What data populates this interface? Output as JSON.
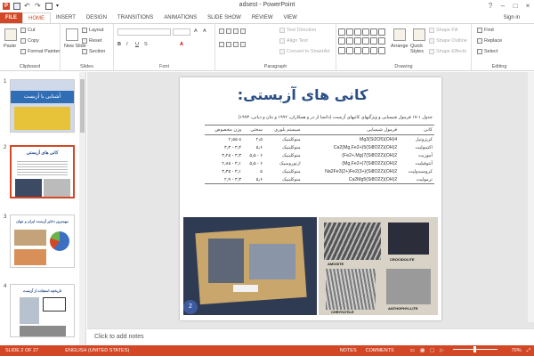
{
  "window": {
    "title": "adsest - PowerPoint",
    "controls": [
      "?",
      "–",
      "□",
      "×"
    ]
  },
  "tabs": [
    "FILE",
    "HOME",
    "INSERT",
    "DESIGN",
    "TRANSITIONS",
    "ANIMATIONS",
    "SLIDE SHOW",
    "REVIEW",
    "VIEW"
  ],
  "active_tab": "HOME",
  "signin": "Sign in",
  "ribbon": {
    "clipboard": {
      "paste": "Paste",
      "cut": "Cut",
      "copy": "Copy",
      "format_painter": "Format Painter",
      "label": "Clipboard"
    },
    "slides": {
      "new_slide": "New Slide",
      "layout": "Layout",
      "reset": "Reset",
      "section": "Section",
      "label": "Slides"
    },
    "font": {
      "label": "Font"
    },
    "paragraph": {
      "text_direction": "Text Direction",
      "align_text": "Align Text",
      "convert_smartart": "Convert to SmartArt",
      "label": "Paragraph"
    },
    "drawing": {
      "arrange": "Arrange",
      "quick_styles": "Quick Styles",
      "shape_fill": "Shape Fill",
      "shape_outline": "Shape Outline",
      "shape_effects": "Shape Effects",
      "label": "Drawing"
    },
    "editing": {
      "find": "Find",
      "replace": "Replace",
      "select": "Select",
      "label": "Editing"
    }
  },
  "thumbnails": [
    {
      "num": "1",
      "title": "آشنایی با آزبست"
    },
    {
      "num": "2",
      "title": "کانی های آزبستی"
    },
    {
      "num": "3",
      "title": "مهمترین ذخایر آزبست ایران و جهان"
    },
    {
      "num": "4",
      "title": "تاریخچه استفاده از آزبست"
    }
  ],
  "slide": {
    "title": "کانی های آزبستی:",
    "caption": "جدول ۱-۱۷ فرمول شیمیایی و ویژگیهای کانیهای آزبست (داتسا از در و همکاران، ۱۹۹۲ و بنان و دیانی، ۱۹۹۳)",
    "headers": [
      "وزن مخصوص",
      "سختی",
      "سیستم بلوری",
      "فرمول شیمیایی",
      "کانی"
    ],
    "rows": [
      [
        "۲٫۵۵ ≤",
        "۲٫۵",
        "منوکلینیک",
        "Mg3(Si2O5)(OH)4",
        "کریزوتیل"
      ],
      [
        "۳٫۳ - ۳٫۴",
        "۵٫۶",
        "منوکلینیک",
        "Ca2(Mg,Fe2+)5(Si8O22)(OH)2",
        "اکتینولیت"
      ],
      [
        "۳٫۲۵ - ۳٫۳",
        "۵٫۵ - ۶",
        "منوکلینیک",
        "(Fe2+,Mg)7(Si8O22)(OH)2",
        "آموزیت"
      ],
      [
        "۲٫۸۵ - ۳٫۱",
        "۵٫۵ - ۶",
        "ارتورومبیک",
        "(Mg,Fe2+)7(Si8O22)(OH)2",
        "آنتوفیلیت"
      ],
      [
        "۳٫۳۵ - ۳٫۱",
        "۵",
        "منوکلینیک",
        "Na2Fe3(2+)Fe2(3+)(Si8O22)(OH)2",
        "کروسیدولیت"
      ],
      [
        "۲٫۹ - ۳٫۳",
        "۵٫۶",
        "منوکلینیک",
        "Ca2Mg5(Si8O22)(OH)2",
        "ترمولیت"
      ]
    ],
    "photo_labels": [
      "AMOSITE",
      "CROCIDOLITE",
      "CHRYSOTILE",
      "ANTHOPHYLLITE"
    ],
    "page_number": "2"
  },
  "notes_placeholder": "Click to add notes",
  "status": {
    "slide": "SLIDE 2 OF 27",
    "language": "ENGLISH (UNITED STATES)",
    "notes": "NOTES",
    "comments": "COMMENTS",
    "zoom": "70%"
  },
  "colors": {
    "accent": "#d24726",
    "title_blue": "#2a4f86"
  }
}
